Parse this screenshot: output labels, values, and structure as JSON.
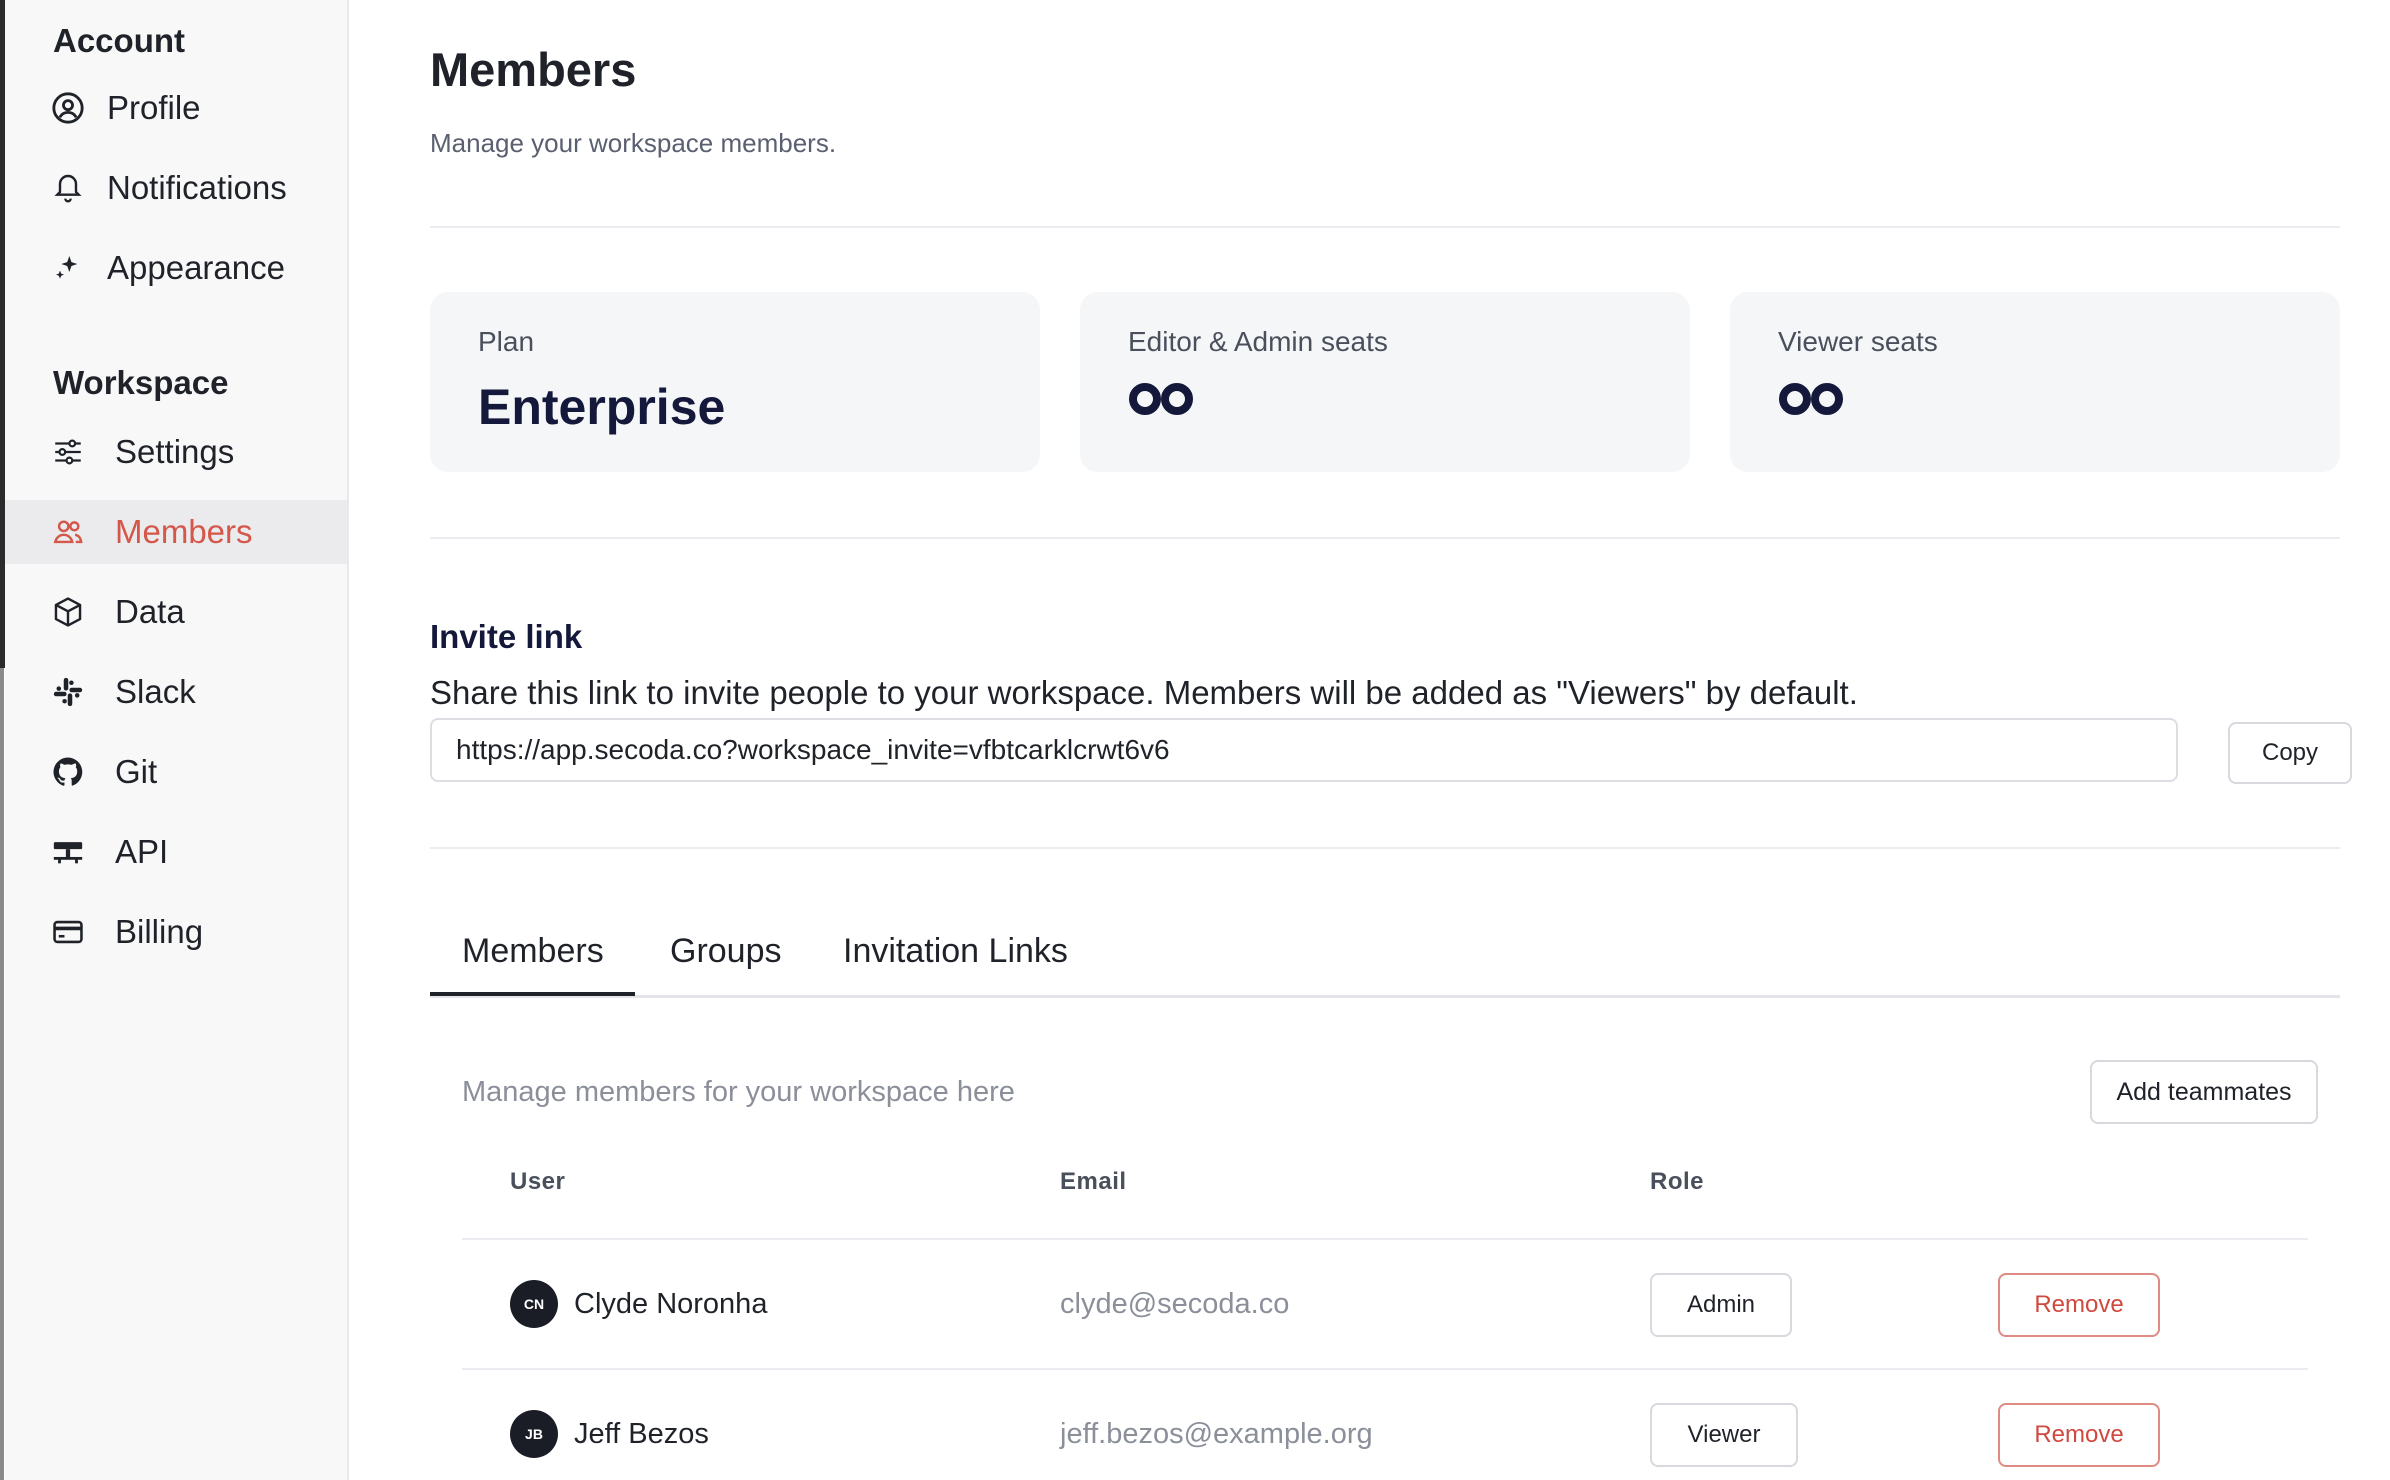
{
  "sidebar": {
    "account_title": "Account",
    "workspace_title": "Workspace",
    "account_items": [
      {
        "label": "Profile",
        "icon": "user-circle-icon"
      },
      {
        "label": "Notifications",
        "icon": "bell-icon"
      },
      {
        "label": "Appearance",
        "icon": "sparkle-icon"
      }
    ],
    "workspace_items": [
      {
        "label": "Settings",
        "icon": "sliders-icon"
      },
      {
        "label": "Members",
        "icon": "users-icon",
        "active": true
      },
      {
        "label": "Data",
        "icon": "cube-icon"
      },
      {
        "label": "Slack",
        "icon": "slack-icon"
      },
      {
        "label": "Git",
        "icon": "github-icon"
      },
      {
        "label": "API",
        "icon": "api-icon"
      },
      {
        "label": "Billing",
        "icon": "credit-card-icon"
      }
    ]
  },
  "header": {
    "title": "Members",
    "subtitle": "Manage your workspace members."
  },
  "cards": [
    {
      "label": "Plan",
      "value": "Enterprise"
    },
    {
      "label": "Editor & Admin seats",
      "value": "∞",
      "icon": "infinity-icon"
    },
    {
      "label": "Viewer seats",
      "value": "∞",
      "icon": "infinity-icon"
    }
  ],
  "invite": {
    "title": "Invite link",
    "description": "Share this link to invite people to your workspace. Members will be added as \"Viewers\" by default.",
    "link": "https://app.secoda.co?workspace_invite=vfbtcarklcrwt6v6",
    "copy_label": "Copy"
  },
  "tabs": [
    {
      "label": "Members",
      "active": true
    },
    {
      "label": "Groups"
    },
    {
      "label": "Invitation Links"
    }
  ],
  "members_panel": {
    "description": "Manage members for your workspace here",
    "add_label": "Add teammates",
    "columns": [
      "User",
      "Email",
      "Role"
    ],
    "rows": [
      {
        "initials": "CN",
        "name": "Clyde Noronha",
        "email": "clyde@secoda.co",
        "role": "Admin",
        "action": "Remove"
      },
      {
        "initials": "JB",
        "name": "Jeff Bezos",
        "email": "jeff.bezos@example.org",
        "role": "Viewer",
        "action": "Remove"
      }
    ]
  },
  "colors": {
    "accent": "#d4574a",
    "danger": "#d0493f",
    "card_bg": "#f5f6f8",
    "sidebar_bg": "#f8f8f9"
  }
}
